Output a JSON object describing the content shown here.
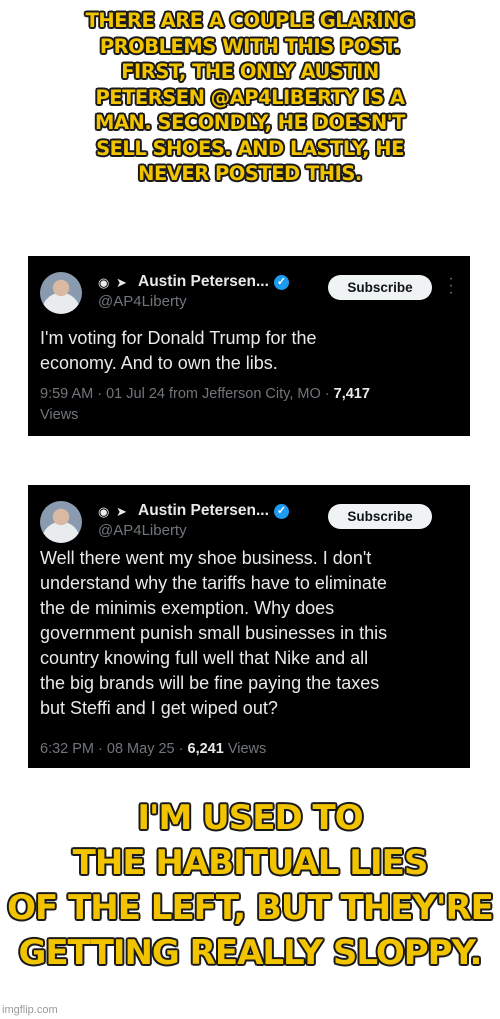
{
  "top_caption": {
    "lines": [
      "THERE ARE A COUPLE GLARING",
      "PROBLEMS WITH THIS POST.",
      "FIRST, THE ONLY AUSTIN",
      "PETERSEN @AP4LIBERTY IS A",
      "MAN. SECONDLY, HE DOESN'T",
      "SELL SHOES. AND LASTLY, HE",
      "NEVER POSTED THIS."
    ]
  },
  "tweets": [
    {
      "display_name": "Austin Petersen...",
      "handle": "@AP4Liberty",
      "subscribe_label": "Subscribe",
      "body_lines": [
        "I'm voting for Donald Trump for the",
        "economy. And to own the libs."
      ],
      "time": "9:59 AM",
      "date": "01 Jul 24",
      "location": "from Jefferson City, MO",
      "views": "7,417",
      "views_label": "Views"
    },
    {
      "display_name": "Austin Petersen...",
      "handle": "@AP4Liberty",
      "subscribe_label": "Subscribe",
      "body_lines": [
        "Well there went my shoe business. I don't",
        "understand why the tariffs have to eliminate",
        "the de minimis exemption. Why does",
        "government punish small businesses in this",
        "country knowing full well that Nike and all",
        "the big brands will be fine paying the taxes",
        "but Steffi and I get wiped out?"
      ],
      "time": "6:32 PM",
      "date": "08 May 25",
      "views": "6,241",
      "views_label": "Views"
    }
  ],
  "bottom_caption": {
    "lines": [
      "I'M USED TO",
      "THE HABITUAL LIES",
      "OF THE LEFT, BUT THEY'RE",
      "GETTING REALLY SLOPPY."
    ]
  },
  "watermark": "imgflip.com",
  "colors": {
    "caption_fill": "#f2c400",
    "caption_outline": "#1a1a1a",
    "tweet_background": "#000000",
    "verified_blue": "#1d9bf0"
  },
  "icons": [
    "ninja-icon",
    "rocket-icon",
    "verified-icon",
    "more-icon"
  ]
}
